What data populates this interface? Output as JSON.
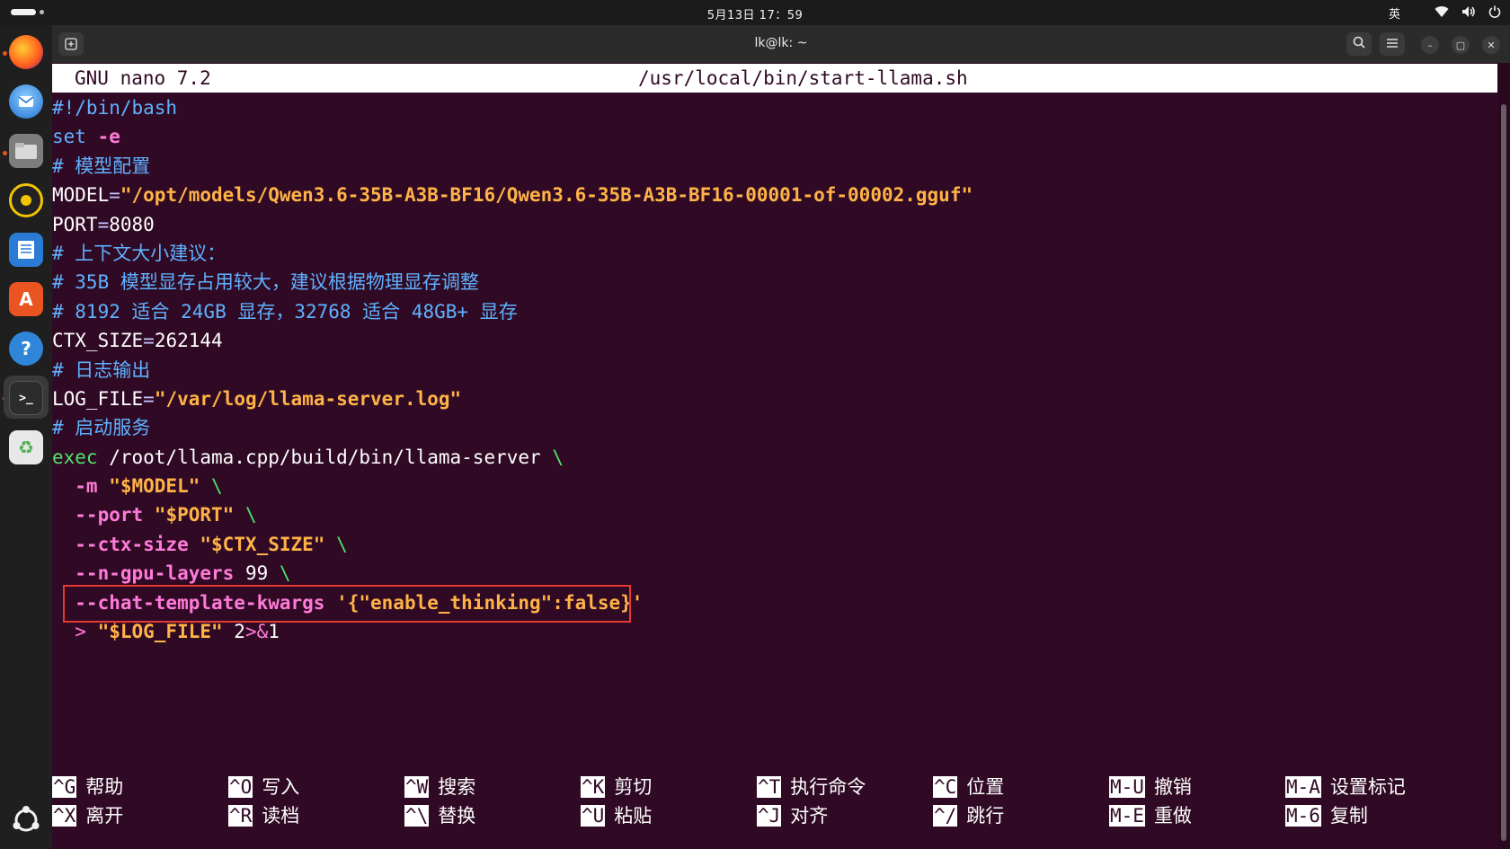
{
  "topbar": {
    "clock": "5月13日 17：59",
    "input_method": "英",
    "icons": [
      "wifi-icon",
      "volume-icon",
      "power-icon"
    ]
  },
  "dock": {
    "apps": [
      {
        "name": "Firefox",
        "icon": "firefox-icon",
        "color": "#ff7139",
        "running": true
      },
      {
        "name": "Thunderbird",
        "icon": "thunderbird-icon",
        "color": "#2f86d8",
        "running": false
      },
      {
        "name": "Files",
        "icon": "files-icon",
        "color": "#8a8a8a",
        "running": true
      },
      {
        "name": "Rhythmbox",
        "icon": "rhythmbox-icon",
        "color": "#e8c400",
        "running": false
      },
      {
        "name": "LibreOffice Writer",
        "icon": "writer-icon",
        "color": "#2a7bd4",
        "running": false
      },
      {
        "name": "App Center",
        "icon": "appcenter-icon",
        "color": "#e95420",
        "running": false
      },
      {
        "name": "Help",
        "icon": "help-icon",
        "color": "#2f86d8",
        "running": false
      },
      {
        "name": "Terminal",
        "icon": "terminal-icon",
        "color": "#3a3a3a",
        "running": true
      },
      {
        "name": "Trash",
        "icon": "trash-icon",
        "color": "#4caf50",
        "running": false
      }
    ],
    "show_apps": "show-apps-icon"
  },
  "window": {
    "title": "lk@lk: ~"
  },
  "nano": {
    "version": "GNU nano 7.2",
    "file": "/usr/local/bin/start-llama.sh"
  },
  "code": {
    "l1": "#!/bin/bash",
    "l2a": "set",
    "l2b": " -e",
    "l3": "# 模型配置",
    "l4a": "MODEL",
    "l4b": "=",
    "l4c": "\"/opt/models/Qwen3.6-35B-A3B-BF16/Qwen3.6-35B-A3B-BF16-00001-of-00002.gguf\"",
    "l5a": "PORT",
    "l5b": "=",
    "l5c": "8080",
    "l6": "# 上下文大小建议：",
    "l7": "# 35B 模型显存占用较大，建议根据物理显存调整",
    "l8": "# 8192 适合 24GB 显存，32768 适合 48GB+ 显存",
    "l9a": "CTX_SIZE",
    "l9b": "=",
    "l9c": "262144",
    "l10": "# 日志输出",
    "l11a": "LOG_FILE",
    "l11b": "=",
    "l11c": "\"/var/log/llama-server.log\"",
    "l12": "# 启动服务",
    "l13a": "exec",
    "l13b": " /root/llama.cpp/build/bin/llama-server ",
    "l13c": "\\",
    "l14a": "  -m",
    "l14b": " \"$MODEL\" ",
    "l14c": "\\",
    "l15a": "  --port",
    "l15b": " \"$PORT\" ",
    "l15c": "\\",
    "l16a": "  --ctx-size",
    "l16b": " \"$CTX_SIZE\" ",
    "l16c": "\\",
    "l17a": "  --n-gpu-layers",
    "l17b": " 99 ",
    "l17c": "\\",
    "l18a": "  --chat-template-kwargs",
    "l18b": " '{\"enable_thinking\":false}'",
    "l19a": "  > ",
    "l19b": "\"$LOG_FILE\"",
    "l19c": " 2",
    "l19d": ">&",
    "l19e": "1"
  },
  "shortcuts": [
    {
      "key": "^G",
      "label": "帮助"
    },
    {
      "key": "^X",
      "label": "离开"
    },
    {
      "key": "^O",
      "label": "写入"
    },
    {
      "key": "^R",
      "label": "读档"
    },
    {
      "key": "^W",
      "label": "搜索"
    },
    {
      "key": "^\\",
      "label": "替换"
    },
    {
      "key": "^K",
      "label": "剪切"
    },
    {
      "key": "^U",
      "label": "粘贴"
    },
    {
      "key": "^T",
      "label": "执行命令"
    },
    {
      "key": "^J",
      "label": "对齐"
    },
    {
      "key": "^C",
      "label": "位置"
    },
    {
      "key": "^/",
      "label": "跳行"
    },
    {
      "key": "M-U",
      "label": "撤销"
    },
    {
      "key": "M-E",
      "label": "重做"
    },
    {
      "key": "M-A",
      "label": "设置标记"
    },
    {
      "key": "M-6",
      "label": "复制"
    }
  ]
}
